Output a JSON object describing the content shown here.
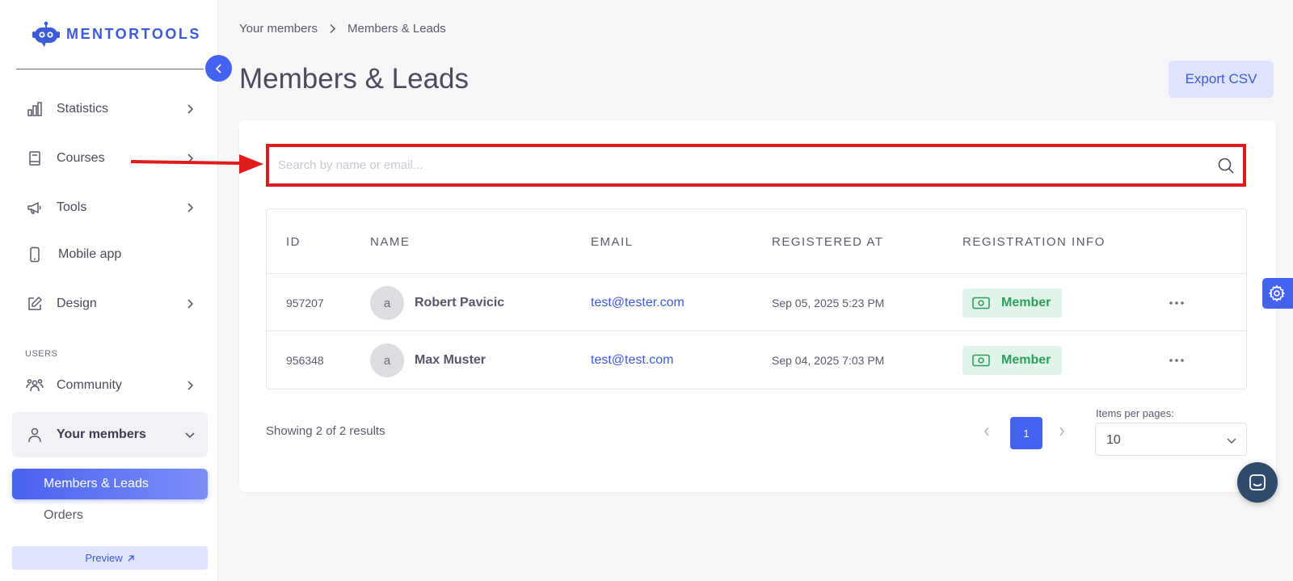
{
  "brand": {
    "name": "MENTORTOOLS",
    "color": "#3b5bdb",
    "icon": "robot-icon"
  },
  "sidebar": {
    "collapse_icon": "chevron-left-icon",
    "items": [
      {
        "label": "Statistics",
        "icon": "bar-chart-icon",
        "has_chevron": true
      },
      {
        "label": "Courses",
        "icon": "book-icon",
        "has_chevron": true
      },
      {
        "label": "Tools",
        "icon": "megaphone-icon",
        "has_chevron": true
      },
      {
        "label": "Mobile app",
        "icon": "smartphone-icon",
        "has_chevron": false
      },
      {
        "label": "Design",
        "icon": "pen-square-icon",
        "has_chevron": true
      }
    ],
    "section_users": "USERS",
    "users_items": [
      {
        "label": "Community",
        "icon": "group-icon",
        "has_chevron": true
      },
      {
        "label": "Your members",
        "icon": "user-icon",
        "expanded": true
      }
    ],
    "sub_items": [
      {
        "label": "Members & Leads",
        "active": true
      },
      {
        "label": "Orders",
        "active": false
      }
    ],
    "preview_label": "Preview"
  },
  "breadcrumb": {
    "parent": "Your members",
    "current": "Members & Leads"
  },
  "page": {
    "title": "Members & Leads",
    "export_label": "Export CSV"
  },
  "search": {
    "placeholder": "Search by name or email...",
    "value": ""
  },
  "table": {
    "columns": [
      "ID",
      "NAME",
      "EMAIL",
      "REGISTERED AT",
      "REGISTRATION INFO"
    ],
    "rows": [
      {
        "id": "957207",
        "avatar": "a",
        "name": "Robert Pavicic",
        "email": "test@tester.com",
        "registered_at": "Sep 05, 2025 5:23 PM",
        "info": "Member"
      },
      {
        "id": "956348",
        "avatar": "a",
        "name": "Max Muster",
        "email": "test@test.com",
        "registered_at": "Sep 04, 2025 7:03 PM",
        "info": "Member"
      }
    ]
  },
  "pagination": {
    "results_text": "Showing 2 of 2 results",
    "current_page": "1",
    "items_per_page_label": "Items per pages:",
    "items_per_page": "10"
  },
  "colors": {
    "primary": "#4662f0",
    "member_badge_bg": "#e1f4ea",
    "member_badge_text": "#2e9e5e",
    "highlight": "#e01b1b",
    "chat": "#2f4a6b"
  }
}
